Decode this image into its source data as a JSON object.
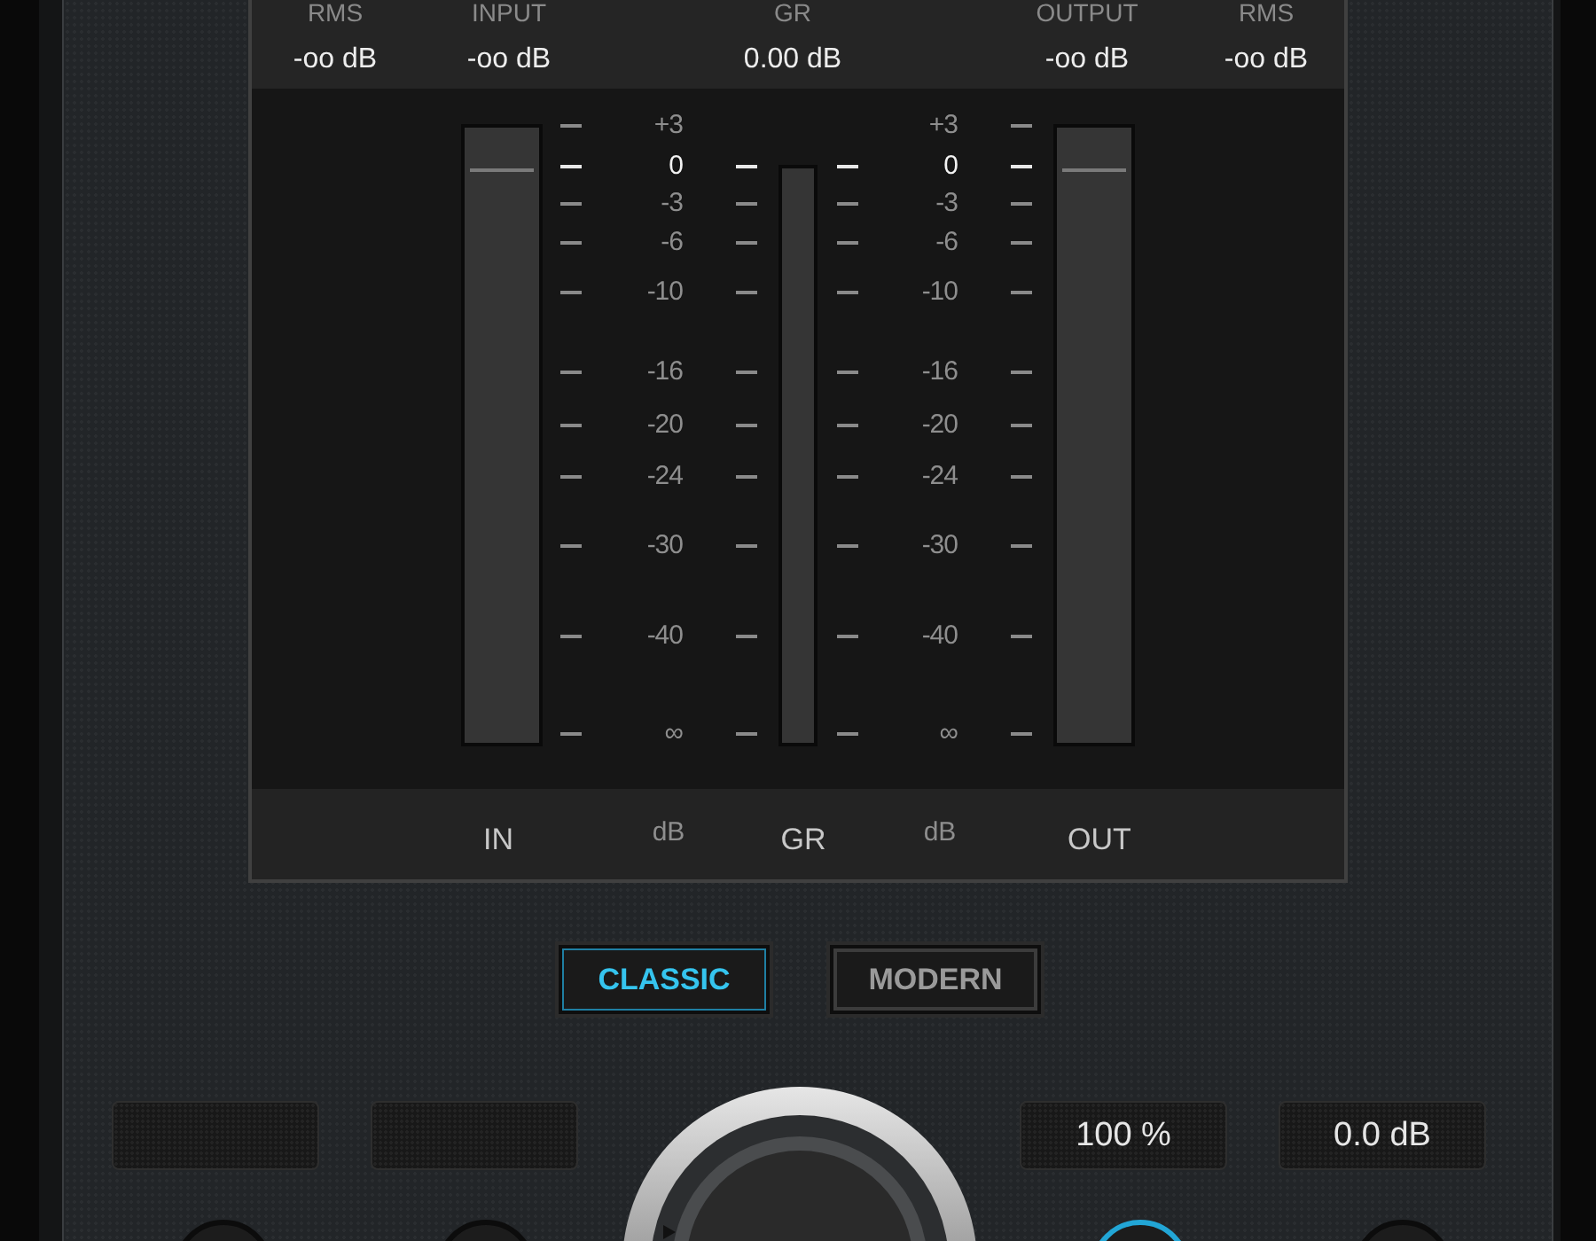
{
  "meter_header": [
    {
      "label": "RMS",
      "value": "-oo dB"
    },
    {
      "label": "INPUT",
      "value": "-oo dB"
    },
    {
      "label": "GR",
      "value": "0.00 dB"
    },
    {
      "label": "OUTPUT",
      "value": "-oo dB"
    },
    {
      "label": "RMS",
      "value": "-oo dB"
    }
  ],
  "meters": [
    {
      "level": 0
    },
    {
      "level": 0
    },
    {
      "level": 0
    }
  ],
  "scales": [
    {
      "labels": [
        {
          "text": "+3",
          "major": false
        },
        {
          "text": "0",
          "major": true
        },
        {
          "text": "-3",
          "major": false
        },
        {
          "text": "-6",
          "major": false
        },
        {
          "text": "-10",
          "major": false
        },
        {
          "text": "-16",
          "major": false
        },
        {
          "text": "-20",
          "major": false
        },
        {
          "text": "-24",
          "major": false
        },
        {
          "text": "-30",
          "major": false
        },
        {
          "text": "-40",
          "major": false
        },
        {
          "text": "∞",
          "major": false
        }
      ]
    },
    {
      "labels": [
        {
          "text": "+3",
          "major": false
        },
        {
          "text": "0",
          "major": true
        },
        {
          "text": "-3",
          "major": false
        },
        {
          "text": "-6",
          "major": false
        },
        {
          "text": "-10",
          "major": false
        },
        {
          "text": "-16",
          "major": false
        },
        {
          "text": "-20",
          "major": false
        },
        {
          "text": "-24",
          "major": false
        },
        {
          "text": "-30",
          "major": false
        },
        {
          "text": "-40",
          "major": false
        },
        {
          "text": "∞",
          "major": false
        }
      ]
    }
  ],
  "meter_footer": [
    {
      "text": "IN",
      "kind": "label"
    },
    {
      "text": "dB",
      "kind": "unit"
    },
    {
      "text": "GR",
      "kind": "label"
    },
    {
      "text": "dB",
      "kind": "unit"
    },
    {
      "text": "OUT",
      "kind": "label"
    }
  ],
  "modes": [
    {
      "label": "CLASSIC",
      "selected": true
    },
    {
      "label": "MODERN",
      "selected": false
    }
  ],
  "parameter_displays": [
    "100 %",
    "0.0 dB"
  ],
  "small_knobs": [
    {
      "active": false
    },
    {
      "active": false
    },
    {
      "active": true
    },
    {
      "active": false
    }
  ]
}
